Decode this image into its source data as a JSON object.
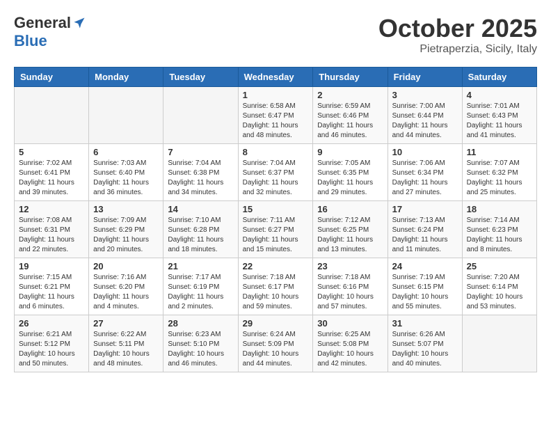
{
  "logo": {
    "general": "General",
    "blue": "Blue"
  },
  "title": {
    "month": "October 2025",
    "location": "Pietraperzia, Sicily, Italy"
  },
  "weekdays": [
    "Sunday",
    "Monday",
    "Tuesday",
    "Wednesday",
    "Thursday",
    "Friday",
    "Saturday"
  ],
  "weeks": [
    [
      {
        "day": "",
        "info": ""
      },
      {
        "day": "",
        "info": ""
      },
      {
        "day": "",
        "info": ""
      },
      {
        "day": "1",
        "info": "Sunrise: 6:58 AM\nSunset: 6:47 PM\nDaylight: 11 hours\nand 48 minutes."
      },
      {
        "day": "2",
        "info": "Sunrise: 6:59 AM\nSunset: 6:46 PM\nDaylight: 11 hours\nand 46 minutes."
      },
      {
        "day": "3",
        "info": "Sunrise: 7:00 AM\nSunset: 6:44 PM\nDaylight: 11 hours\nand 44 minutes."
      },
      {
        "day": "4",
        "info": "Sunrise: 7:01 AM\nSunset: 6:43 PM\nDaylight: 11 hours\nand 41 minutes."
      }
    ],
    [
      {
        "day": "5",
        "info": "Sunrise: 7:02 AM\nSunset: 6:41 PM\nDaylight: 11 hours\nand 39 minutes."
      },
      {
        "day": "6",
        "info": "Sunrise: 7:03 AM\nSunset: 6:40 PM\nDaylight: 11 hours\nand 36 minutes."
      },
      {
        "day": "7",
        "info": "Sunrise: 7:04 AM\nSunset: 6:38 PM\nDaylight: 11 hours\nand 34 minutes."
      },
      {
        "day": "8",
        "info": "Sunrise: 7:04 AM\nSunset: 6:37 PM\nDaylight: 11 hours\nand 32 minutes."
      },
      {
        "day": "9",
        "info": "Sunrise: 7:05 AM\nSunset: 6:35 PM\nDaylight: 11 hours\nand 29 minutes."
      },
      {
        "day": "10",
        "info": "Sunrise: 7:06 AM\nSunset: 6:34 PM\nDaylight: 11 hours\nand 27 minutes."
      },
      {
        "day": "11",
        "info": "Sunrise: 7:07 AM\nSunset: 6:32 PM\nDaylight: 11 hours\nand 25 minutes."
      }
    ],
    [
      {
        "day": "12",
        "info": "Sunrise: 7:08 AM\nSunset: 6:31 PM\nDaylight: 11 hours\nand 22 minutes."
      },
      {
        "day": "13",
        "info": "Sunrise: 7:09 AM\nSunset: 6:29 PM\nDaylight: 11 hours\nand 20 minutes."
      },
      {
        "day": "14",
        "info": "Sunrise: 7:10 AM\nSunset: 6:28 PM\nDaylight: 11 hours\nand 18 minutes."
      },
      {
        "day": "15",
        "info": "Sunrise: 7:11 AM\nSunset: 6:27 PM\nDaylight: 11 hours\nand 15 minutes."
      },
      {
        "day": "16",
        "info": "Sunrise: 7:12 AM\nSunset: 6:25 PM\nDaylight: 11 hours\nand 13 minutes."
      },
      {
        "day": "17",
        "info": "Sunrise: 7:13 AM\nSunset: 6:24 PM\nDaylight: 11 hours\nand 11 minutes."
      },
      {
        "day": "18",
        "info": "Sunrise: 7:14 AM\nSunset: 6:23 PM\nDaylight: 11 hours\nand 8 minutes."
      }
    ],
    [
      {
        "day": "19",
        "info": "Sunrise: 7:15 AM\nSunset: 6:21 PM\nDaylight: 11 hours\nand 6 minutes."
      },
      {
        "day": "20",
        "info": "Sunrise: 7:16 AM\nSunset: 6:20 PM\nDaylight: 11 hours\nand 4 minutes."
      },
      {
        "day": "21",
        "info": "Sunrise: 7:17 AM\nSunset: 6:19 PM\nDaylight: 11 hours\nand 2 minutes."
      },
      {
        "day": "22",
        "info": "Sunrise: 7:18 AM\nSunset: 6:17 PM\nDaylight: 10 hours\nand 59 minutes."
      },
      {
        "day": "23",
        "info": "Sunrise: 7:18 AM\nSunset: 6:16 PM\nDaylight: 10 hours\nand 57 minutes."
      },
      {
        "day": "24",
        "info": "Sunrise: 7:19 AM\nSunset: 6:15 PM\nDaylight: 10 hours\nand 55 minutes."
      },
      {
        "day": "25",
        "info": "Sunrise: 7:20 AM\nSunset: 6:14 PM\nDaylight: 10 hours\nand 53 minutes."
      }
    ],
    [
      {
        "day": "26",
        "info": "Sunrise: 6:21 AM\nSunset: 5:12 PM\nDaylight: 10 hours\nand 50 minutes."
      },
      {
        "day": "27",
        "info": "Sunrise: 6:22 AM\nSunset: 5:11 PM\nDaylight: 10 hours\nand 48 minutes."
      },
      {
        "day": "28",
        "info": "Sunrise: 6:23 AM\nSunset: 5:10 PM\nDaylight: 10 hours\nand 46 minutes."
      },
      {
        "day": "29",
        "info": "Sunrise: 6:24 AM\nSunset: 5:09 PM\nDaylight: 10 hours\nand 44 minutes."
      },
      {
        "day": "30",
        "info": "Sunrise: 6:25 AM\nSunset: 5:08 PM\nDaylight: 10 hours\nand 42 minutes."
      },
      {
        "day": "31",
        "info": "Sunrise: 6:26 AM\nSunset: 5:07 PM\nDaylight: 10 hours\nand 40 minutes."
      },
      {
        "day": "",
        "info": ""
      }
    ]
  ]
}
